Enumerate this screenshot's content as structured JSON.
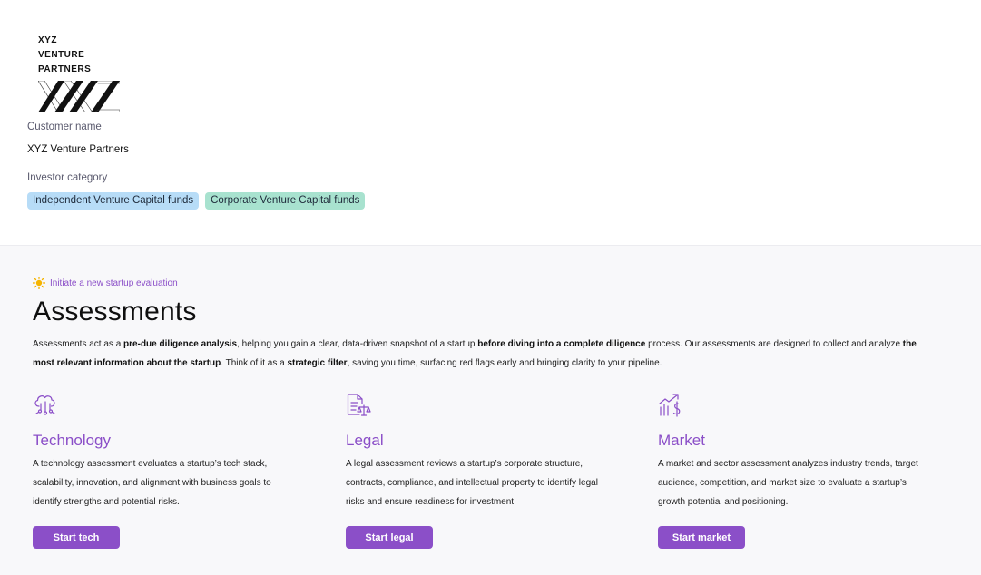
{
  "customer": {
    "logo_lines": [
      "XYZ",
      "VENTURE",
      "PARTNERS"
    ],
    "name_label": "Customer name",
    "name_value": "XYZ Venture Partners",
    "category_label": "Investor category",
    "categories": [
      {
        "label": "Independent Venture Capital funds",
        "color": "#b7dcf7"
      },
      {
        "label": "Corporate Venture Capital funds",
        "color": "#a8e2cf"
      }
    ]
  },
  "assessments": {
    "eyebrow": "Initiate a new startup evaluation",
    "title": "Assessments",
    "description": [
      {
        "text": "Assessments act as a ",
        "bold": false
      },
      {
        "text": "pre-due diligence analysis",
        "bold": true
      },
      {
        "text": ", helping you gain a clear, data-driven snapshot of a startup ",
        "bold": false
      },
      {
        "text": "before diving into a complete diligence",
        "bold": true
      },
      {
        "text": " process. Our assessments are designed to collect and analyze ",
        "bold": false
      },
      {
        "text": "the most relevant information about the startup",
        "bold": true
      },
      {
        "text": ". Think of it as a ",
        "bold": false
      },
      {
        "text": "strategic filter",
        "bold": true
      },
      {
        "text": ", saving you time, surfacing red flags early and bringing clarity to your pipeline.",
        "bold": false
      }
    ],
    "cards": [
      {
        "icon": "cloud-network-icon",
        "title": "Technology",
        "text": "A technology assessment evaluates a startup’s tech stack, scalability, innovation, and alignment with business goals to identify strengths and potential risks.",
        "button": "Start tech"
      },
      {
        "icon": "legal-document-icon",
        "title": "Legal",
        "text": "A legal assessment reviews a startup’s corporate structure, contracts, compliance, and intellectual property to identify legal risks and ensure readiness for investment.",
        "button": "Start legal"
      },
      {
        "icon": "market-growth-icon",
        "title": "Market",
        "text": "A market and sector assessment analyzes industry trends, target audience, competition, and market size to evaluate a startup’s growth potential and positioning.",
        "button": "Start market"
      }
    ]
  },
  "colors": {
    "accent": "#8b4fc8",
    "section_bg": "#f8f8fa"
  }
}
